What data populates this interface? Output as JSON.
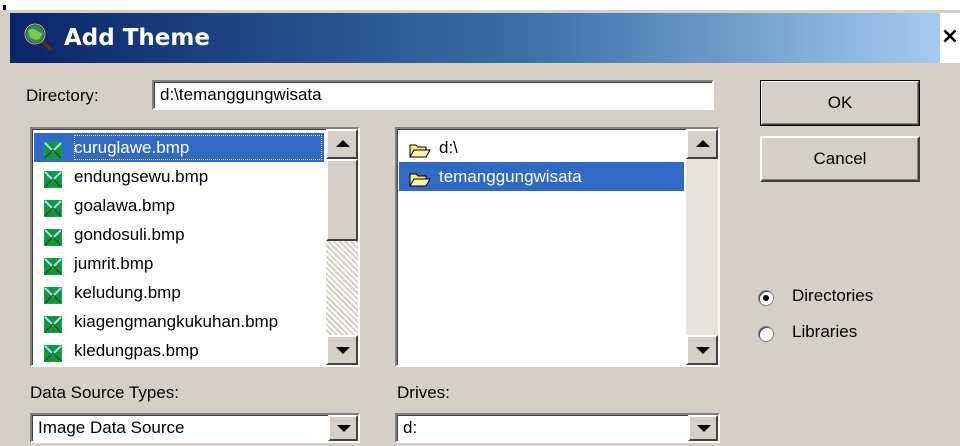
{
  "window": {
    "title": "Add Theme",
    "close_label": "×"
  },
  "directory": {
    "label": "Directory:",
    "value": "d:\\temanggungwisata"
  },
  "buttons": {
    "ok_label": "OK",
    "cancel_label": "Cancel"
  },
  "file_list": {
    "items": [
      {
        "name": "curuglawe.bmp",
        "selected": true
      },
      {
        "name": "endungsewu.bmp"
      },
      {
        "name": "goalawa.bmp"
      },
      {
        "name": "gondosuli.bmp"
      },
      {
        "name": "jumrit.bmp"
      },
      {
        "name": "keludung.bmp"
      },
      {
        "name": "kiagengmangkukuhan.bmp"
      },
      {
        "name": "kledungpas.bmp"
      }
    ]
  },
  "dir_list": {
    "items": [
      {
        "name": "d:\\"
      },
      {
        "name": "temanggungwisata",
        "selected": true
      }
    ]
  },
  "data_source": {
    "label": "Data Source Types:",
    "value": "Image Data Source"
  },
  "drives": {
    "label": "Drives:",
    "value": "d:"
  },
  "browse_mode": {
    "options": [
      {
        "label": "Directories",
        "checked": true
      },
      {
        "label": "Libraries",
        "checked": false
      }
    ]
  },
  "colors": {
    "title_bar_start": "#0a246a",
    "title_bar_end": "#a6caf0",
    "selection": "#316ac5",
    "face": "#d4d0c8"
  },
  "icons": {
    "app": "magnifier-globe-icon",
    "file": "image-file-icon",
    "folder": "folder-icon",
    "open_folder": "open-folder-icon"
  }
}
